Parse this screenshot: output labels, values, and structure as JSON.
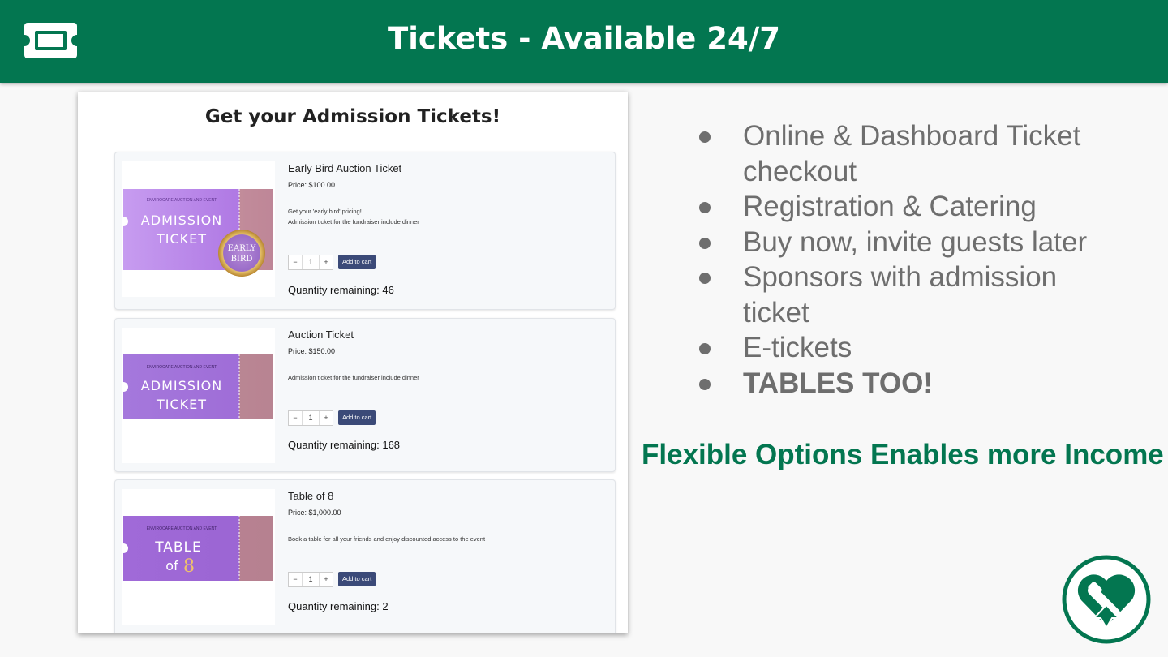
{
  "header": {
    "title": "Tickets - Available 24/7",
    "icon": "ticket-icon",
    "background": "#037650"
  },
  "shot": {
    "title": "Get your Admission Tickets!",
    "tickets": [
      {
        "name": "Early Bird Auction Ticket",
        "price": "Price: $100.00",
        "desc1": "Get your 'early bird' pricing!",
        "desc2": "Admission ticket for the fundraiser include dinner",
        "img_org": "ENVIROCARE AUCTION AND EVENT",
        "img_line1": "ADMISSION",
        "img_line2": "TICKET",
        "badge_line1": "EARLY",
        "badge_line2": "BIRD",
        "qty_value": "1",
        "add_label": "Add to cart",
        "remaining": "Quantity remaining: 46"
      },
      {
        "name": "Auction Ticket",
        "price": "Price: $150.00",
        "desc1": "Admission ticket for the fundraiser include dinner",
        "img_org": "ENVIROCARE AUCTION AND EVENT",
        "img_line1": "ADMISSION",
        "img_line2": "TICKET",
        "qty_value": "1",
        "add_label": "Add to cart",
        "remaining": "Quantity remaining: 168"
      },
      {
        "name": "Table of 8",
        "price": "Price: $1,000.00",
        "desc1": "Book a table for all your friends and enjoy discounted access to the event",
        "img_org": "ENVIROCARE AUCTION AND EVENT",
        "img_line1": "TABLE",
        "img_line2_a": "of",
        "img_line2_b": "8",
        "qty_value": "1",
        "add_label": "Add to cart",
        "remaining": "Quantity remaining: 2"
      }
    ]
  },
  "bullets": [
    "Online & Dashboard Ticket checkout",
    "Registration & Catering",
    "Buy now, invite guests later",
    "Sponsors with admission ticket",
    "E-tickets",
    "TABLES TOO!"
  ],
  "tagline": "Flexible Options Enables more Income",
  "logo": {
    "icon": "heart-hand-ribbon-logo",
    "color": "#037650"
  },
  "colors": {
    "ticket_purple": "#a86ee0",
    "ticket_gold": "#d9a441",
    "button": "#3b4a78",
    "bullet_text": "#6e6e6e"
  }
}
